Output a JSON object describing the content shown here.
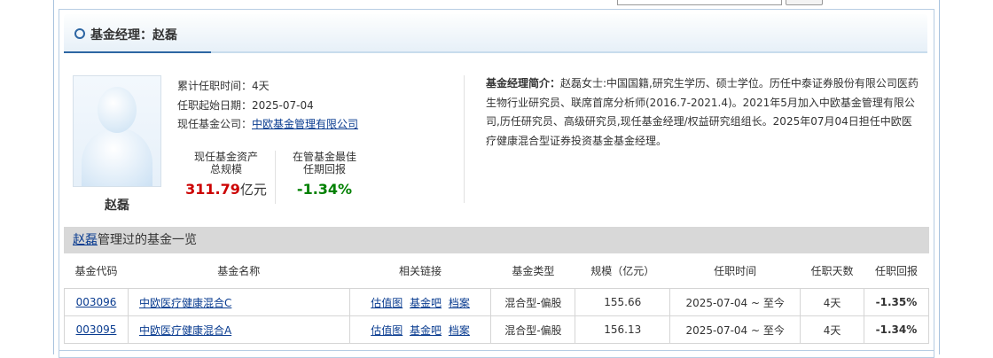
{
  "header": {
    "title": "基金经理：赵磊"
  },
  "manager": {
    "name": "赵磊",
    "tenure_label": "累计任职时间：",
    "tenure_value": "4天",
    "start_label": "任职起始日期：",
    "start_value": "2025-07-04",
    "company_label": "现任基金公司：",
    "company_value": "中欧基金管理有限公司"
  },
  "stats": {
    "assets_label_1": "现任基金资产",
    "assets_label_2": "总规模",
    "assets_value": "311.79",
    "assets_unit": "亿元",
    "return_label_1": "在管基金最佳",
    "return_label_2": "任期回报",
    "return_value": "-1.34%"
  },
  "bio": {
    "label": "基金经理简介：",
    "text": "赵磊女士:中国国籍,研究生学历、硕士学位。历任中泰证券股份有限公司医药生物行业研究员、联席首席分析师(2016.7-2021.4)。2021年5月加入中欧基金管理有限公司,历任研究员、高级研究员,现任基金经理/权益研究组组长。2025年07月04日担任中欧医疗健康混合型证券投资基金基金经理。"
  },
  "section": {
    "name_link": "赵磊",
    "title_suffix": "管理过的基金一览"
  },
  "table": {
    "headers": [
      "基金代码",
      "基金名称",
      "相关链接",
      "基金类型",
      "规模（亿元）",
      "任职时间",
      "任职天数",
      "任职回报"
    ],
    "rows": [
      {
        "code": "003096",
        "name": "中欧医疗健康混合C",
        "links": [
          "估值图",
          "基金吧",
          "档案"
        ],
        "type": "混合型-偏股",
        "size": "155.66",
        "period": "2025-07-04 ~ 至今",
        "days": "4天",
        "return": "-1.35%"
      },
      {
        "code": "003095",
        "name": "中欧医疗健康混合A",
        "links": [
          "估值图",
          "基金吧",
          "档案"
        ],
        "type": "混合型-偏股",
        "size": "156.13",
        "period": "2025-07-04 ~ 至今",
        "days": "4天",
        "return": "-1.34%"
      }
    ]
  },
  "colors": {
    "accent_blue": "#2d66a3",
    "link": "#0a3c90",
    "negative_return": "#008000",
    "asset_red": "#cc0000",
    "section_bg": "#d8d8d8"
  }
}
